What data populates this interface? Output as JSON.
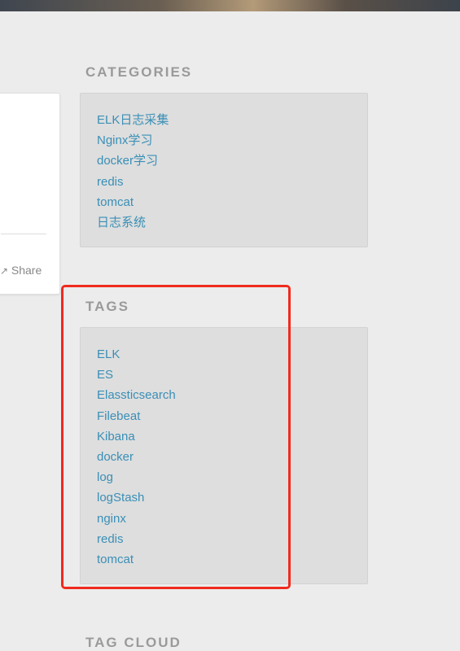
{
  "sidebar": {
    "categories": {
      "title": "CATEGORIES",
      "items": [
        {
          "label": "ELK日志采集"
        },
        {
          "label": "Nginx学习"
        },
        {
          "label": "docker学习"
        },
        {
          "label": "redis"
        },
        {
          "label": "tomcat"
        },
        {
          "label": "日志系统"
        }
      ]
    },
    "tags": {
      "title": "TAGS",
      "items": [
        {
          "label": "ELK"
        },
        {
          "label": "ES"
        },
        {
          "label": "Elassticsearch"
        },
        {
          "label": "Filebeat"
        },
        {
          "label": "Kibana"
        },
        {
          "label": "docker"
        },
        {
          "label": "log"
        },
        {
          "label": "logStash"
        },
        {
          "label": "nginx"
        },
        {
          "label": "redis"
        },
        {
          "label": "tomcat"
        }
      ]
    },
    "tag_cloud": {
      "title": "TAG CLOUD"
    }
  },
  "post": {
    "share_label": "Share",
    "share_icon": "share-arrow-icon"
  },
  "colors": {
    "link": "#3a8fb6",
    "widget_title": "#9a9a9a",
    "widget_bg": "#dedede",
    "page_bg": "#ececec",
    "highlight": "#f02a1e"
  }
}
